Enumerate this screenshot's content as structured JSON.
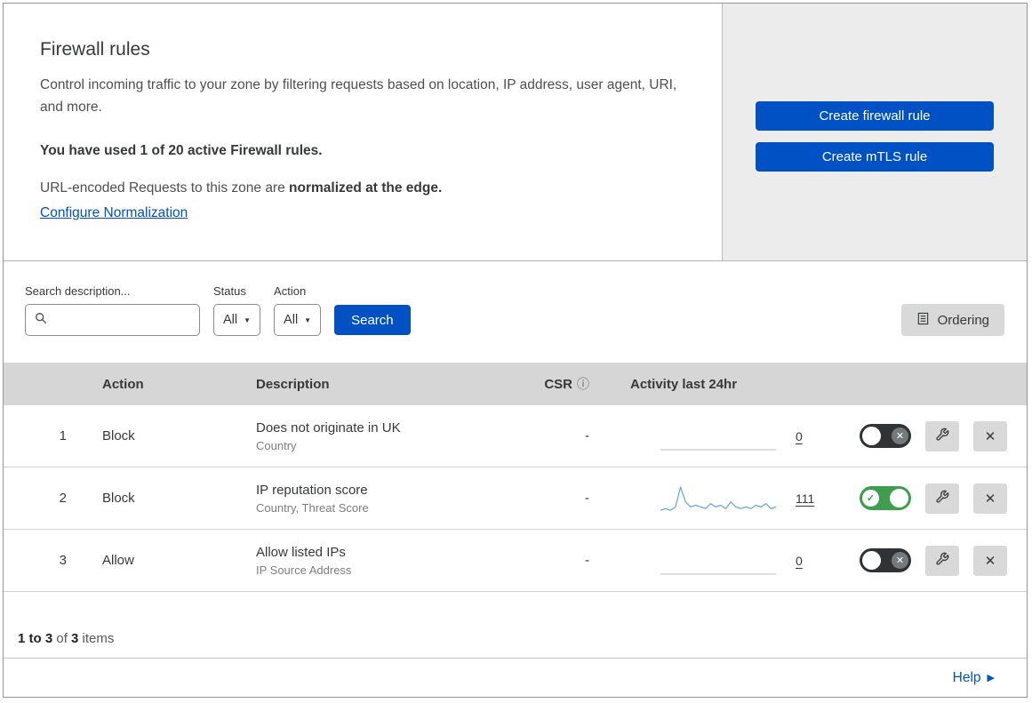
{
  "header": {
    "title": "Firewall rules",
    "description": "Control incoming traffic to your zone by filtering requests based on location, IP address, user agent, URI, and more.",
    "usage": "You have used 1 of 20 active Firewall rules.",
    "normalization_prefix": "URL-encoded Requests to this zone are ",
    "normalization_bold": "normalized at the edge.",
    "normalization_link": "Configure Normalization",
    "buttons": {
      "create_firewall_rule": "Create firewall rule",
      "create_mtls_rule": "Create mTLS rule"
    }
  },
  "filters": {
    "search_label": "Search description...",
    "search_value": "",
    "status_label": "Status",
    "status_value": "All",
    "action_label": "Action",
    "action_value": "All",
    "search_button": "Search",
    "ordering_button": "Ordering"
  },
  "table": {
    "columns": {
      "action": "Action",
      "description": "Description",
      "csr": "CSR",
      "activity": "Activity last 24hr"
    },
    "rows": [
      {
        "priority": "1",
        "action": "Block",
        "description": "Does not originate in UK",
        "fields": "Country",
        "csr": "-",
        "activity": "0",
        "enabled": false,
        "sparkline": {
          "type": "line",
          "values": [
            0,
            0,
            0,
            0,
            0,
            0,
            0,
            0,
            0,
            0,
            0,
            0,
            0,
            0,
            0,
            0,
            0,
            0,
            0,
            0,
            0,
            0,
            0,
            0
          ],
          "color": "#c9c9c9"
        }
      },
      {
        "priority": "2",
        "action": "Block",
        "description": "IP reputation score",
        "fields": "Country, Threat Score",
        "csr": "-",
        "activity": "111",
        "enabled": true,
        "sparkline": {
          "type": "line",
          "values": [
            1,
            2,
            1,
            3,
            15,
            6,
            3,
            4,
            3,
            2,
            5,
            3,
            4,
            2,
            6,
            3,
            2,
            3,
            2,
            4,
            3,
            5,
            2,
            3
          ],
          "color": "#6fa8dc"
        }
      },
      {
        "priority": "3",
        "action": "Allow",
        "description": "Allow listed IPs",
        "fields": "IP Source Address",
        "csr": "-",
        "activity": "0",
        "enabled": false,
        "sparkline": {
          "type": "line",
          "values": [
            0,
            0,
            0,
            0,
            0,
            0,
            0,
            0,
            0,
            0,
            0,
            0,
            0,
            0,
            0,
            0,
            0,
            0,
            0,
            0,
            0,
            0,
            0,
            0
          ],
          "color": "#c9c9c9"
        }
      }
    ]
  },
  "footer": {
    "range": "1 to 3",
    "of_text": " of ",
    "total": "3",
    "items_text": " items"
  },
  "help": {
    "label": "Help"
  },
  "icons": {
    "caret": "▼",
    "info": "ⓘ",
    "check": "✓",
    "x": "✕",
    "help_arrow": "▶"
  },
  "colors": {
    "primary_blue": "#0051c3",
    "toggle_on_green": "#3f9d4f",
    "toggle_off_dark": "#303336",
    "sparkline_blue": "#6fa8dc",
    "table_header_gray": "#d6d6d6"
  }
}
